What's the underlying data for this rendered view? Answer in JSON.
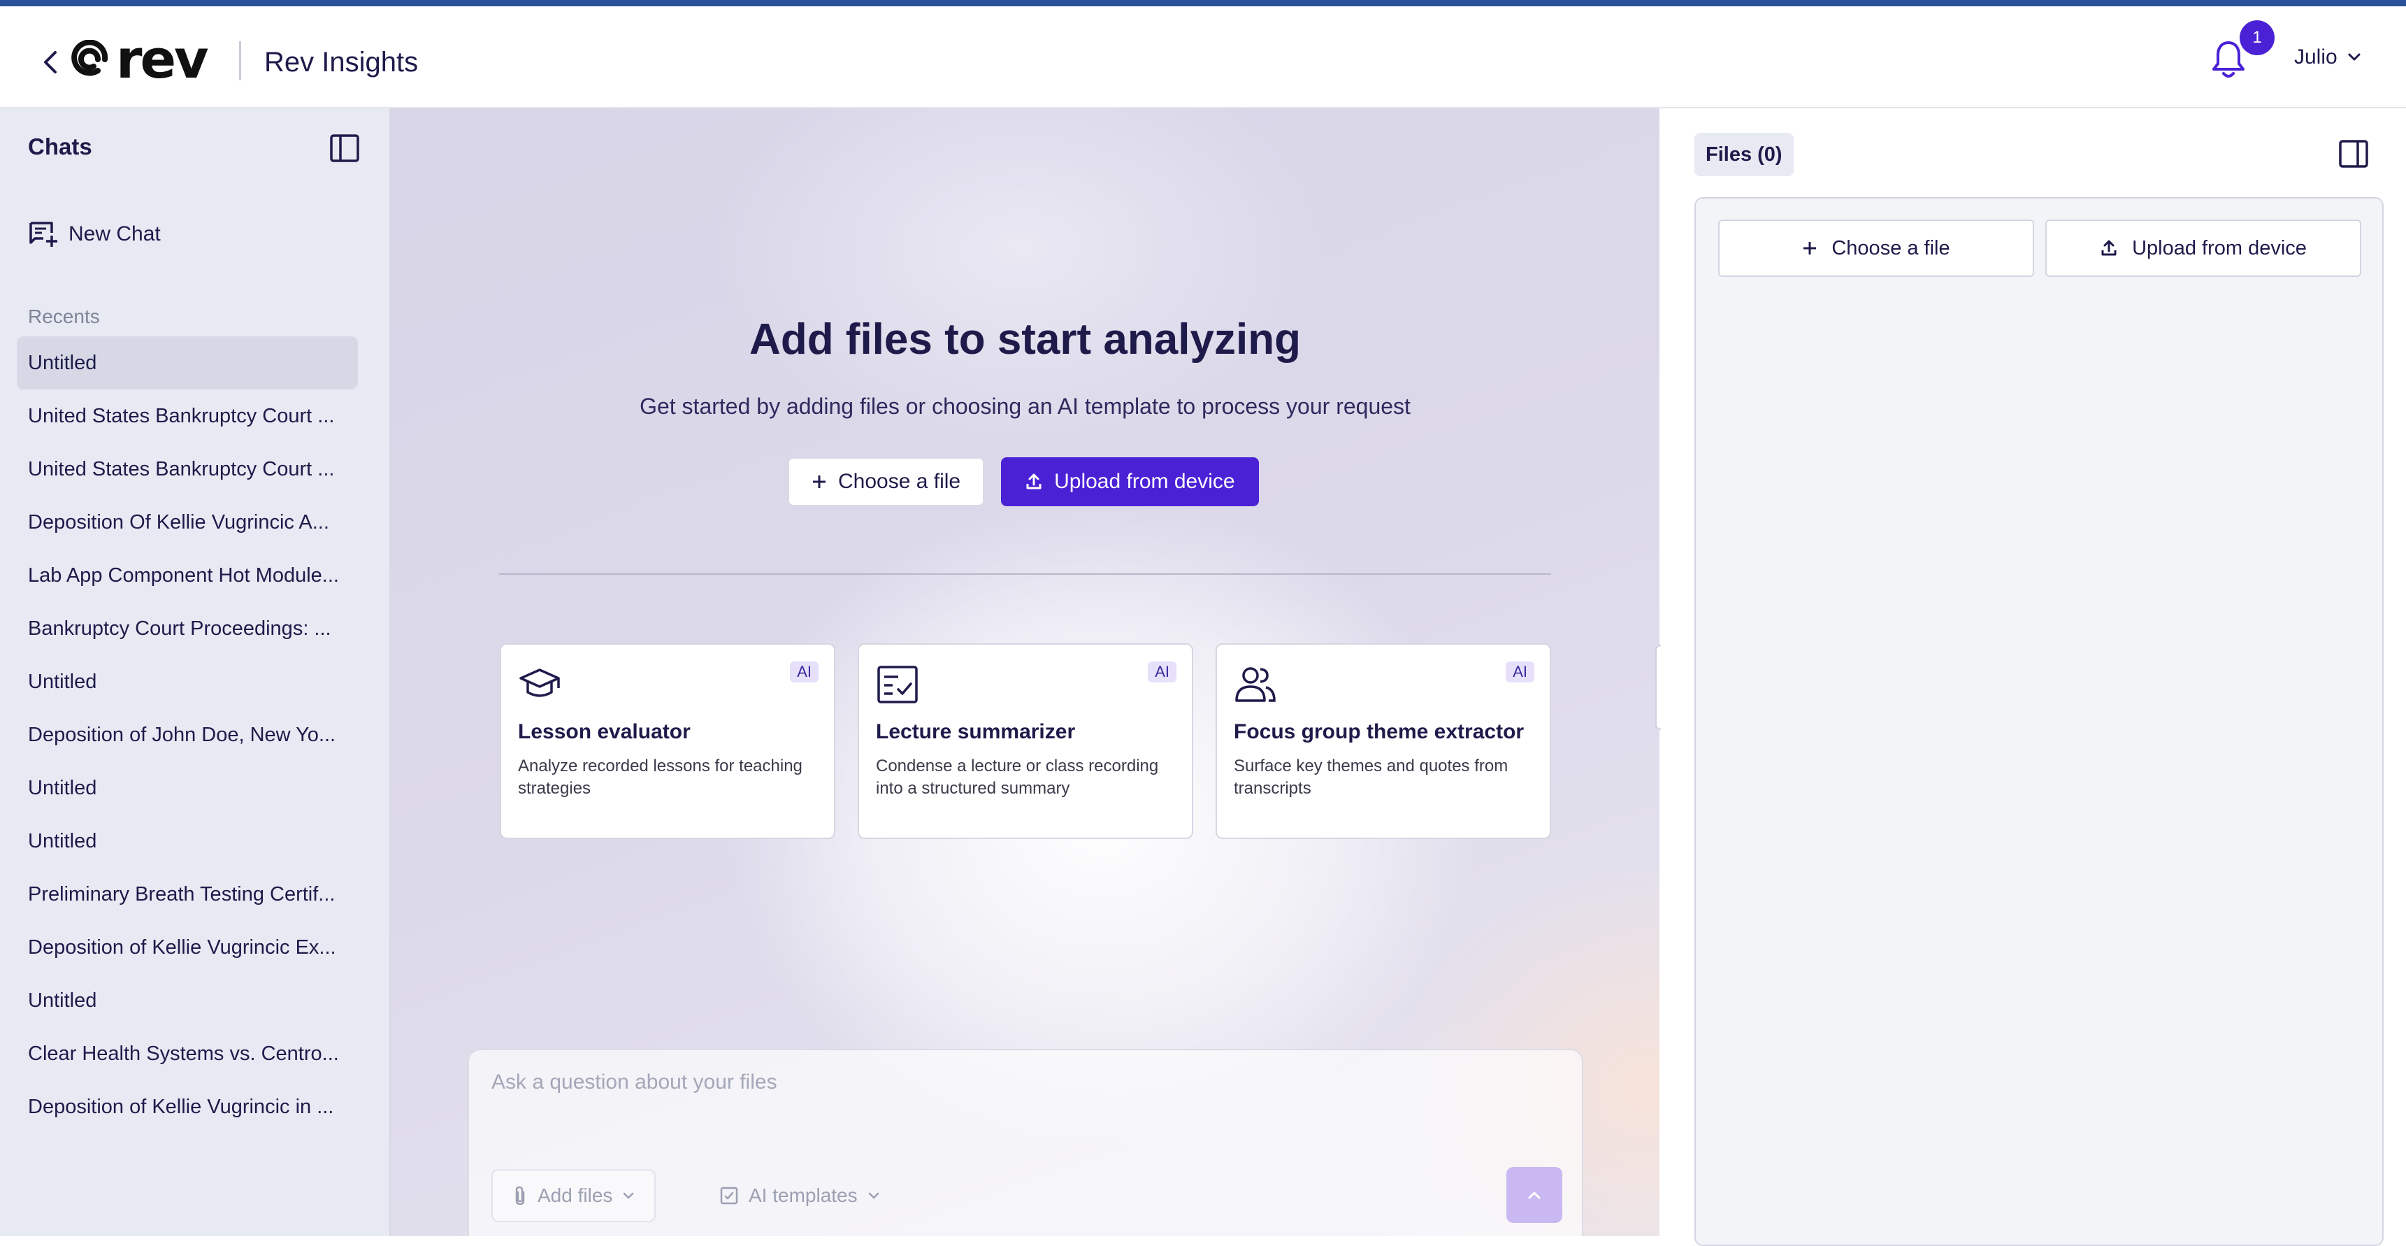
{
  "header": {
    "logo_text": "rev",
    "app_title": "Rev Insights",
    "notification_count": "1",
    "user_name": "Julio"
  },
  "sidebar": {
    "title": "Chats",
    "new_chat_label": "New Chat",
    "recents_label": "Recents",
    "recents": [
      {
        "label": "Untitled",
        "active": true
      },
      {
        "label": "United States Bankruptcy Court ..."
      },
      {
        "label": "United States Bankruptcy Court ..."
      },
      {
        "label": "Deposition Of Kellie Vugrincic A..."
      },
      {
        "label": "Lab App Component Hot Module..."
      },
      {
        "label": "Bankruptcy Court Proceedings: ..."
      },
      {
        "label": "Untitled"
      },
      {
        "label": "Deposition of John Doe, New Yo..."
      },
      {
        "label": "Untitled"
      },
      {
        "label": "Untitled"
      },
      {
        "label": "Preliminary Breath Testing Certif..."
      },
      {
        "label": "Deposition of Kellie Vugrincic Ex..."
      },
      {
        "label": "Untitled"
      },
      {
        "label": "Clear Health Systems vs. Centro..."
      },
      {
        "label": "Deposition of Kellie Vugrincic in ..."
      }
    ]
  },
  "main": {
    "heading": "Add files to start analyzing",
    "subheading": "Get started by adding files or choosing an AI template to process your request",
    "choose_file_label": "Choose a file",
    "upload_label": "Upload from device",
    "templates": [
      {
        "title": "Lesson evaluator",
        "description": "Analyze recorded lessons for teaching strategies",
        "badge": "AI",
        "icon": "graduation-cap-icon"
      },
      {
        "title": "Lecture summarizer",
        "description": "Condense a lecture or class recording into a structured summary",
        "badge": "AI",
        "icon": "checklist-icon"
      },
      {
        "title": "Focus group theme extractor",
        "description": "Surface key themes and quotes from transcripts",
        "badge": "AI",
        "icon": "users-icon"
      }
    ]
  },
  "chat": {
    "placeholder": "Ask a question about your files",
    "add_files_label": "Add files",
    "ai_templates_label": "AI templates"
  },
  "files_panel": {
    "tab_label": "Files (0)",
    "choose_file_label": "Choose a file",
    "upload_label": "Upload from device"
  },
  "colors": {
    "primary": "#4b21d6",
    "accent_bar": "#2a5298",
    "text": "#1e1b4b",
    "sidebar_bg": "#e8eaf3"
  }
}
